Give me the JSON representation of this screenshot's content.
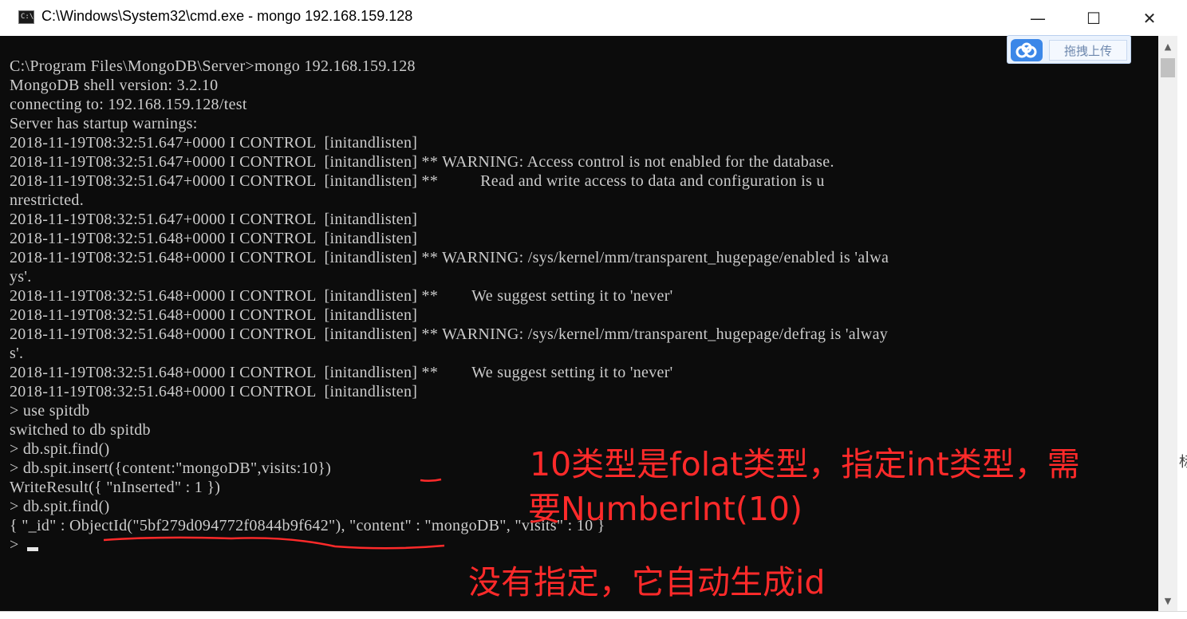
{
  "window": {
    "title": "C:\\Windows\\System32\\cmd.exe - mongo  192.168.159.128",
    "minimize_glyph": "—",
    "maximize_glyph": "☐",
    "close_glyph": "✕"
  },
  "upload_widget": {
    "icon": "baidu-cloud-icon",
    "button_label": "拖拽上传"
  },
  "console": {
    "lines": [
      "C:\\Program Files\\MongoDB\\Server>mongo 192.168.159.128",
      "MongoDB shell version: 3.2.10",
      "connecting to: 192.168.159.128/test",
      "Server has startup warnings:",
      "2018-11-19T08:32:51.647+0000 I CONTROL  [initandlisten]",
      "2018-11-19T08:32:51.647+0000 I CONTROL  [initandlisten] ** WARNING: Access control is not enabled for the database.",
      "2018-11-19T08:32:51.647+0000 I CONTROL  [initandlisten] **          Read and write access to data and configuration is u",
      "nrestricted.",
      "2018-11-19T08:32:51.647+0000 I CONTROL  [initandlisten]",
      "2018-11-19T08:32:51.648+0000 I CONTROL  [initandlisten]",
      "2018-11-19T08:32:51.648+0000 I CONTROL  [initandlisten] ** WARNING: /sys/kernel/mm/transparent_hugepage/enabled is 'alwa",
      "ys'.",
      "2018-11-19T08:32:51.648+0000 I CONTROL  [initandlisten] **        We suggest setting it to 'never'",
      "2018-11-19T08:32:51.648+0000 I CONTROL  [initandlisten]",
      "2018-11-19T08:32:51.648+0000 I CONTROL  [initandlisten] ** WARNING: /sys/kernel/mm/transparent_hugepage/defrag is 'alway",
      "s'.",
      "2018-11-19T08:32:51.648+0000 I CONTROL  [initandlisten] **        We suggest setting it to 'never'",
      "2018-11-19T08:32:51.648+0000 I CONTROL  [initandlisten]",
      "> use spitdb",
      "switched to db spitdb",
      "> db.spit.find()",
      "> db.spit.insert({content:\"mongoDB\",visits:10})",
      "WriteResult({ \"nInserted\" : 1 })",
      "> db.spit.find()",
      "{ \"_id\" : ObjectId(\"5bf279d094772f0844b9f642\"), \"content\" : \"mongoDB\", \"visits\" : 10 }",
      ">"
    ]
  },
  "annotations": {
    "float_note_line1": "10类型是folat类型，指定int类型，需",
    "float_note_line2": "要NumberInt(10)",
    "id_note": "没有指定，它自动生成id",
    "color": "#ff2a2a"
  },
  "edge_glyph": "标",
  "colors": {
    "console_bg": "#0c0c0c",
    "console_text": "#cccccc",
    "titlebar_bg": "#ffffff"
  }
}
